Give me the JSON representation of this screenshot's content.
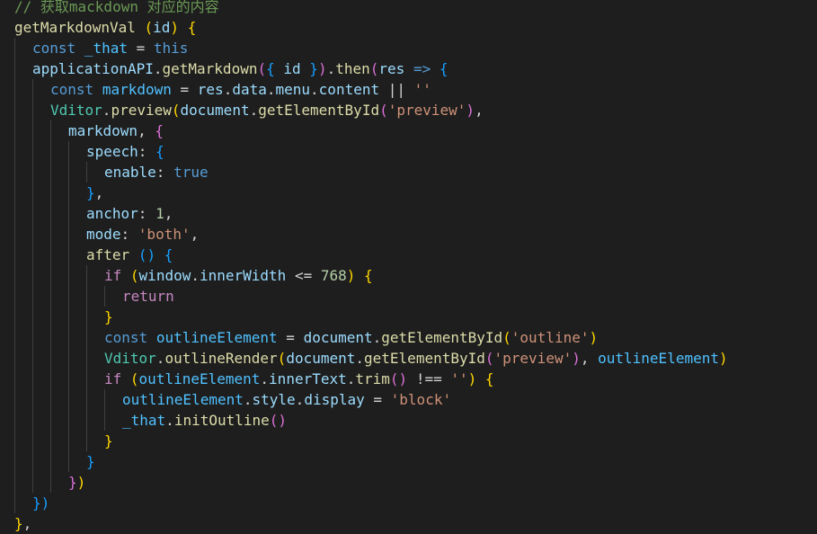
{
  "editor": {
    "language": "javascript",
    "colors": {
      "background": "#1e1e1e",
      "comment": "#6a9955",
      "function": "#dcdcaa",
      "variable": "#9cdcfe",
      "keyword": "#569cd6",
      "control": "#c586c0",
      "string": "#ce9178",
      "number": "#b5cea8",
      "class": "#4ec9b0",
      "bracket_level_1": "#ffd700",
      "bracket_level_2": "#da70d6",
      "bracket_level_3": "#179fff"
    },
    "lines": [
      {
        "indent": 0,
        "tokens": [
          {
            "t": "// 获取mackdown 对应的内容",
            "c": "comment"
          }
        ]
      },
      {
        "indent": 0,
        "tokens": [
          {
            "t": "getMarkdownVal",
            "c": "fn"
          },
          {
            "t": " ",
            "c": "punc"
          },
          {
            "t": "(",
            "c": "b1"
          },
          {
            "t": "id",
            "c": "param"
          },
          {
            "t": ")",
            "c": "b1"
          },
          {
            "t": " ",
            "c": "punc"
          },
          {
            "t": "{",
            "c": "b1"
          }
        ]
      },
      {
        "indent": 1,
        "tokens": [
          {
            "t": "const",
            "c": "kw"
          },
          {
            "t": " ",
            "c": "punc"
          },
          {
            "t": "_that",
            "c": "const"
          },
          {
            "t": " = ",
            "c": "punc"
          },
          {
            "t": "this",
            "c": "kw"
          }
        ]
      },
      {
        "indent": 1,
        "tokens": [
          {
            "t": "applicationAPI",
            "c": "var"
          },
          {
            "t": ".",
            "c": "punc"
          },
          {
            "t": "getMarkdown",
            "c": "fn"
          },
          {
            "t": "(",
            "c": "b2"
          },
          {
            "t": "{",
            "c": "b3"
          },
          {
            "t": " ",
            "c": "punc"
          },
          {
            "t": "id",
            "c": "var"
          },
          {
            "t": " ",
            "c": "punc"
          },
          {
            "t": "}",
            "c": "b3"
          },
          {
            "t": ")",
            "c": "b2"
          },
          {
            "t": ".",
            "c": "punc"
          },
          {
            "t": "then",
            "c": "fn"
          },
          {
            "t": "(",
            "c": "b2"
          },
          {
            "t": "res",
            "c": "param"
          },
          {
            "t": " ",
            "c": "punc"
          },
          {
            "t": "=>",
            "c": "kw"
          },
          {
            "t": " ",
            "c": "punc"
          },
          {
            "t": "{",
            "c": "b3"
          }
        ]
      },
      {
        "indent": 2,
        "tokens": [
          {
            "t": "const",
            "c": "kw"
          },
          {
            "t": " ",
            "c": "punc"
          },
          {
            "t": "markdown",
            "c": "const"
          },
          {
            "t": " = ",
            "c": "punc"
          },
          {
            "t": "res",
            "c": "var"
          },
          {
            "t": ".",
            "c": "punc"
          },
          {
            "t": "data",
            "c": "var"
          },
          {
            "t": ".",
            "c": "punc"
          },
          {
            "t": "menu",
            "c": "var"
          },
          {
            "t": ".",
            "c": "punc"
          },
          {
            "t": "content",
            "c": "var"
          },
          {
            "t": " || ",
            "c": "punc"
          },
          {
            "t": "''",
            "c": "str"
          }
        ]
      },
      {
        "indent": 2,
        "tokens": [
          {
            "t": "Vditor",
            "c": "class"
          },
          {
            "t": ".",
            "c": "punc"
          },
          {
            "t": "preview",
            "c": "fn"
          },
          {
            "t": "(",
            "c": "b1"
          },
          {
            "t": "document",
            "c": "var"
          },
          {
            "t": ".",
            "c": "punc"
          },
          {
            "t": "getElementById",
            "c": "fn"
          },
          {
            "t": "(",
            "c": "b2"
          },
          {
            "t": "'preview'",
            "c": "str"
          },
          {
            "t": ")",
            "c": "b2"
          },
          {
            "t": ",",
            "c": "punc"
          }
        ]
      },
      {
        "indent": 3,
        "tokens": [
          {
            "t": "markdown",
            "c": "var"
          },
          {
            "t": ", ",
            "c": "punc"
          },
          {
            "t": "{",
            "c": "b2"
          }
        ]
      },
      {
        "indent": 4,
        "tokens": [
          {
            "t": "speech",
            "c": "var"
          },
          {
            "t": ": ",
            "c": "punc"
          },
          {
            "t": "{",
            "c": "b3"
          }
        ]
      },
      {
        "indent": 5,
        "tokens": [
          {
            "t": "enable",
            "c": "var"
          },
          {
            "t": ": ",
            "c": "punc"
          },
          {
            "t": "true",
            "c": "kw"
          }
        ]
      },
      {
        "indent": 4,
        "tokens": [
          {
            "t": "}",
            "c": "b3"
          },
          {
            "t": ",",
            "c": "punc"
          }
        ]
      },
      {
        "indent": 4,
        "tokens": [
          {
            "t": "anchor",
            "c": "var"
          },
          {
            "t": ": ",
            "c": "punc"
          },
          {
            "t": "1",
            "c": "num"
          },
          {
            "t": ",",
            "c": "punc"
          }
        ]
      },
      {
        "indent": 4,
        "tokens": [
          {
            "t": "mode",
            "c": "var"
          },
          {
            "t": ": ",
            "c": "punc"
          },
          {
            "t": "'both'",
            "c": "str"
          },
          {
            "t": ",",
            "c": "punc"
          }
        ]
      },
      {
        "indent": 4,
        "tokens": [
          {
            "t": "after",
            "c": "fn"
          },
          {
            "t": " ",
            "c": "punc"
          },
          {
            "t": "()",
            "c": "b3"
          },
          {
            "t": " ",
            "c": "punc"
          },
          {
            "t": "{",
            "c": "b3"
          }
        ]
      },
      {
        "indent": 5,
        "tokens": [
          {
            "t": "if",
            "c": "ctrl"
          },
          {
            "t": " ",
            "c": "punc"
          },
          {
            "t": "(",
            "c": "b1"
          },
          {
            "t": "window",
            "c": "var"
          },
          {
            "t": ".",
            "c": "punc"
          },
          {
            "t": "innerWidth",
            "c": "var"
          },
          {
            "t": " <= ",
            "c": "punc"
          },
          {
            "t": "768",
            "c": "num"
          },
          {
            "t": ")",
            "c": "b1"
          },
          {
            "t": " ",
            "c": "punc"
          },
          {
            "t": "{",
            "c": "b1"
          }
        ]
      },
      {
        "indent": 6,
        "tokens": [
          {
            "t": "return",
            "c": "ctrl"
          }
        ]
      },
      {
        "indent": 5,
        "tokens": [
          {
            "t": "}",
            "c": "b1"
          }
        ]
      },
      {
        "indent": 5,
        "tokens": [
          {
            "t": "const",
            "c": "kw"
          },
          {
            "t": " ",
            "c": "punc"
          },
          {
            "t": "outlineElement",
            "c": "const"
          },
          {
            "t": " = ",
            "c": "punc"
          },
          {
            "t": "document",
            "c": "var"
          },
          {
            "t": ".",
            "c": "punc"
          },
          {
            "t": "getElementById",
            "c": "fn"
          },
          {
            "t": "(",
            "c": "b1"
          },
          {
            "t": "'outline'",
            "c": "str"
          },
          {
            "t": ")",
            "c": "b1"
          }
        ]
      },
      {
        "indent": 5,
        "tokens": [
          {
            "t": "Vditor",
            "c": "class"
          },
          {
            "t": ".",
            "c": "punc"
          },
          {
            "t": "outlineRender",
            "c": "fn"
          },
          {
            "t": "(",
            "c": "b1"
          },
          {
            "t": "document",
            "c": "var"
          },
          {
            "t": ".",
            "c": "punc"
          },
          {
            "t": "getElementById",
            "c": "fn"
          },
          {
            "t": "(",
            "c": "b2"
          },
          {
            "t": "'preview'",
            "c": "str"
          },
          {
            "t": ")",
            "c": "b2"
          },
          {
            "t": ", ",
            "c": "punc"
          },
          {
            "t": "outlineElement",
            "c": "const"
          },
          {
            "t": ")",
            "c": "b1"
          }
        ]
      },
      {
        "indent": 5,
        "tokens": [
          {
            "t": "if",
            "c": "ctrl"
          },
          {
            "t": " ",
            "c": "punc"
          },
          {
            "t": "(",
            "c": "b1"
          },
          {
            "t": "outlineElement",
            "c": "const"
          },
          {
            "t": ".",
            "c": "punc"
          },
          {
            "t": "innerText",
            "c": "var"
          },
          {
            "t": ".",
            "c": "punc"
          },
          {
            "t": "trim",
            "c": "fn"
          },
          {
            "t": "()",
            "c": "b2"
          },
          {
            "t": " !== ",
            "c": "punc"
          },
          {
            "t": "''",
            "c": "str"
          },
          {
            "t": ")",
            "c": "b1"
          },
          {
            "t": " ",
            "c": "punc"
          },
          {
            "t": "{",
            "c": "b1"
          }
        ]
      },
      {
        "indent": 6,
        "tokens": [
          {
            "t": "outlineElement",
            "c": "const"
          },
          {
            "t": ".",
            "c": "punc"
          },
          {
            "t": "style",
            "c": "var"
          },
          {
            "t": ".",
            "c": "punc"
          },
          {
            "t": "display",
            "c": "var"
          },
          {
            "t": " = ",
            "c": "punc"
          },
          {
            "t": "'block'",
            "c": "str"
          }
        ]
      },
      {
        "indent": 6,
        "tokens": [
          {
            "t": "_that",
            "c": "const"
          },
          {
            "t": ".",
            "c": "punc"
          },
          {
            "t": "initOutline",
            "c": "fn"
          },
          {
            "t": "()",
            "c": "b2"
          }
        ]
      },
      {
        "indent": 5,
        "tokens": [
          {
            "t": "}",
            "c": "b1"
          }
        ]
      },
      {
        "indent": 4,
        "tokens": [
          {
            "t": "}",
            "c": "b3"
          }
        ]
      },
      {
        "indent": 3,
        "tokens": [
          {
            "t": "}",
            "c": "b2"
          },
          {
            "t": ")",
            "c": "b1"
          }
        ]
      },
      {
        "indent": 1,
        "tokens": [
          {
            "t": "})",
            "c": "b3"
          }
        ]
      },
      {
        "indent": 0,
        "tokens": [
          {
            "t": "}",
            "c": "b1"
          },
          {
            "t": ",",
            "c": "punc"
          }
        ]
      }
    ]
  }
}
